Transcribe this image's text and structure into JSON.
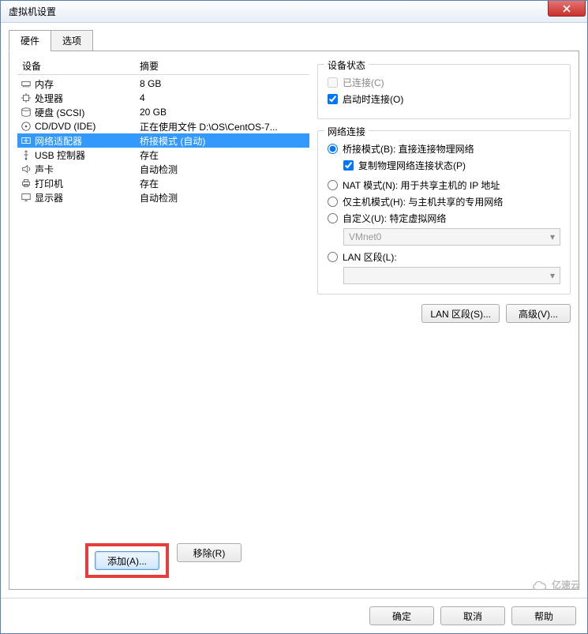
{
  "window": {
    "title": "虚拟机设置"
  },
  "tabs": {
    "hardware": "硬件",
    "options": "选项"
  },
  "columns": {
    "device": "设备",
    "summary": "摘要"
  },
  "devices": [
    {
      "name": "内存",
      "summary": "8 GB",
      "icon": "memory"
    },
    {
      "name": "处理器",
      "summary": "4",
      "icon": "cpu"
    },
    {
      "name": "硬盘 (SCSI)",
      "summary": "20 GB",
      "icon": "disk"
    },
    {
      "name": "CD/DVD (IDE)",
      "summary": "正在使用文件 D:\\OS\\CentOS-7...",
      "icon": "cd"
    },
    {
      "name": "网络适配器",
      "summary": "桥接模式 (自动)",
      "icon": "network",
      "selected": true
    },
    {
      "name": "USB 控制器",
      "summary": "存在",
      "icon": "usb"
    },
    {
      "name": "声卡",
      "summary": "自动检测",
      "icon": "sound"
    },
    {
      "name": "打印机",
      "summary": "存在",
      "icon": "printer"
    },
    {
      "name": "显示器",
      "summary": "自动检测",
      "icon": "display"
    }
  ],
  "left_buttons": {
    "add": "添加(A)...",
    "remove": "移除(R)"
  },
  "status_group": {
    "legend": "设备状态",
    "connected": "已连接(C)",
    "connect_at_start": "启动时连接(O)",
    "connected_checked": false,
    "start_checked": true
  },
  "network_group": {
    "legend": "网络连接",
    "bridged": "桥接模式(B): 直接连接物理网络",
    "replicate": "复制物理网络连接状态(P)",
    "nat": "NAT 模式(N): 用于共享主机的 IP 地址",
    "hostonly": "仅主机模式(H): 与主机共享的专用网络",
    "custom": "自定义(U): 特定虚拟网络",
    "custom_value": "VMnet0",
    "lan": "LAN 区段(L):",
    "selected": "bridged",
    "replicate_checked": true
  },
  "right_buttons": {
    "lan": "LAN 区段(S)...",
    "advanced": "高级(V)..."
  },
  "footer": {
    "ok": "确定",
    "cancel": "取消",
    "help": "帮助"
  },
  "watermark": "亿速云"
}
